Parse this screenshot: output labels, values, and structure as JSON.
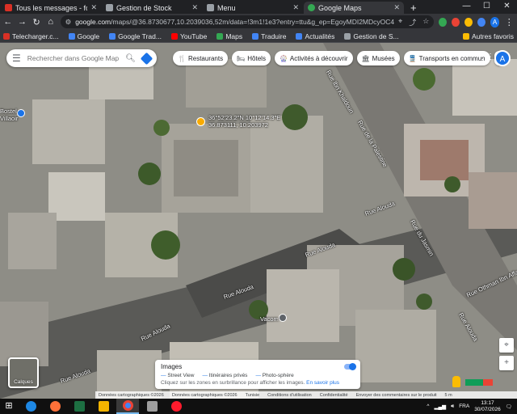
{
  "browser": {
    "tabs": [
      {
        "label": "Tous les messages - for",
        "icon_color": "#d93025"
      },
      {
        "label": "Gestion de Stock",
        "icon_color": "#9aa0a6"
      },
      {
        "label": "Menu",
        "icon_color": "#9aa0a6"
      },
      {
        "label": "Google Maps",
        "icon_color": "#34a853",
        "active": true
      }
    ],
    "new_tab_label": "+",
    "url_prefix": "google.com",
    "url_rest": "/maps/@36.8730677,10.2039036,52m/data=!3m1!1e3?entry=ttu&g_ep=EgoyMDI2MDcyOC4",
    "bookmarks": [
      {
        "label": "Telecharger.c...",
        "icon_color": "#d93025"
      },
      {
        "label": "Google",
        "icon_color": "#4285f4"
      },
      {
        "label": "Google Trad...",
        "icon_color": "#4285f4"
      },
      {
        "label": "YouTube",
        "icon_color": "#ff0000"
      },
      {
        "label": "Maps",
        "icon_color": "#34a853"
      },
      {
        "label": "Traduire",
        "icon_color": "#4285f4"
      },
      {
        "label": "Actualités",
        "icon_color": "#4285f4"
      },
      {
        "label": "Gestion de S...",
        "icon_color": "#9aa0a6"
      }
    ],
    "other_bookmarks": "Autres favoris",
    "profile_initial": "A"
  },
  "maps": {
    "search_placeholder": "Rechercher dans Google Maps",
    "chips": [
      "Restaurants",
      "Hôtels",
      "Activités à découvrir",
      "Musées",
      "Transports en commun"
    ],
    "chip_icons": [
      "🍴",
      "🛏",
      "🎡",
      "🏛",
      "🚆"
    ],
    "account_initial": "A",
    "place_label_1": "36°52'23.2\"N 10°12'14.3\"E",
    "place_label_2": "36.873111, 10.203972",
    "left_place_label": "Bostel\nVillaoir",
    "vacom_label": "Vacom",
    "streets": [
      "Rue Alouda",
      "Rue Alouda",
      "Rue Alouda",
      "Rue Alouda",
      "Rue Alouda",
      "Rue Alouda",
      "Rue Ibn Khaldoun",
      "Rue de la Palestine",
      "Rue Othman Ibn Affan",
      "Rue du Jasmin",
      "Rue Alouda"
    ],
    "layers_label": "Calques",
    "images_panel": {
      "title": "Images",
      "options": [
        "Street View",
        "Itinéraires privés",
        "Photo-sphère"
      ],
      "note": "Cliquez sur les zones en surbrillance pour afficher les images.",
      "link": "En savoir plus"
    },
    "attribution": [
      "Données cartographiques ©2026",
      "Données cartographiques ©2026",
      "Tunisie",
      "Conditions d'utilisation",
      "Confidentialité",
      "Envoyer des commentaires sur le produit",
      "5 m"
    ]
  },
  "taskbar": {
    "time": "13:17",
    "date": "30/07/2026",
    "lang": "FRA"
  }
}
